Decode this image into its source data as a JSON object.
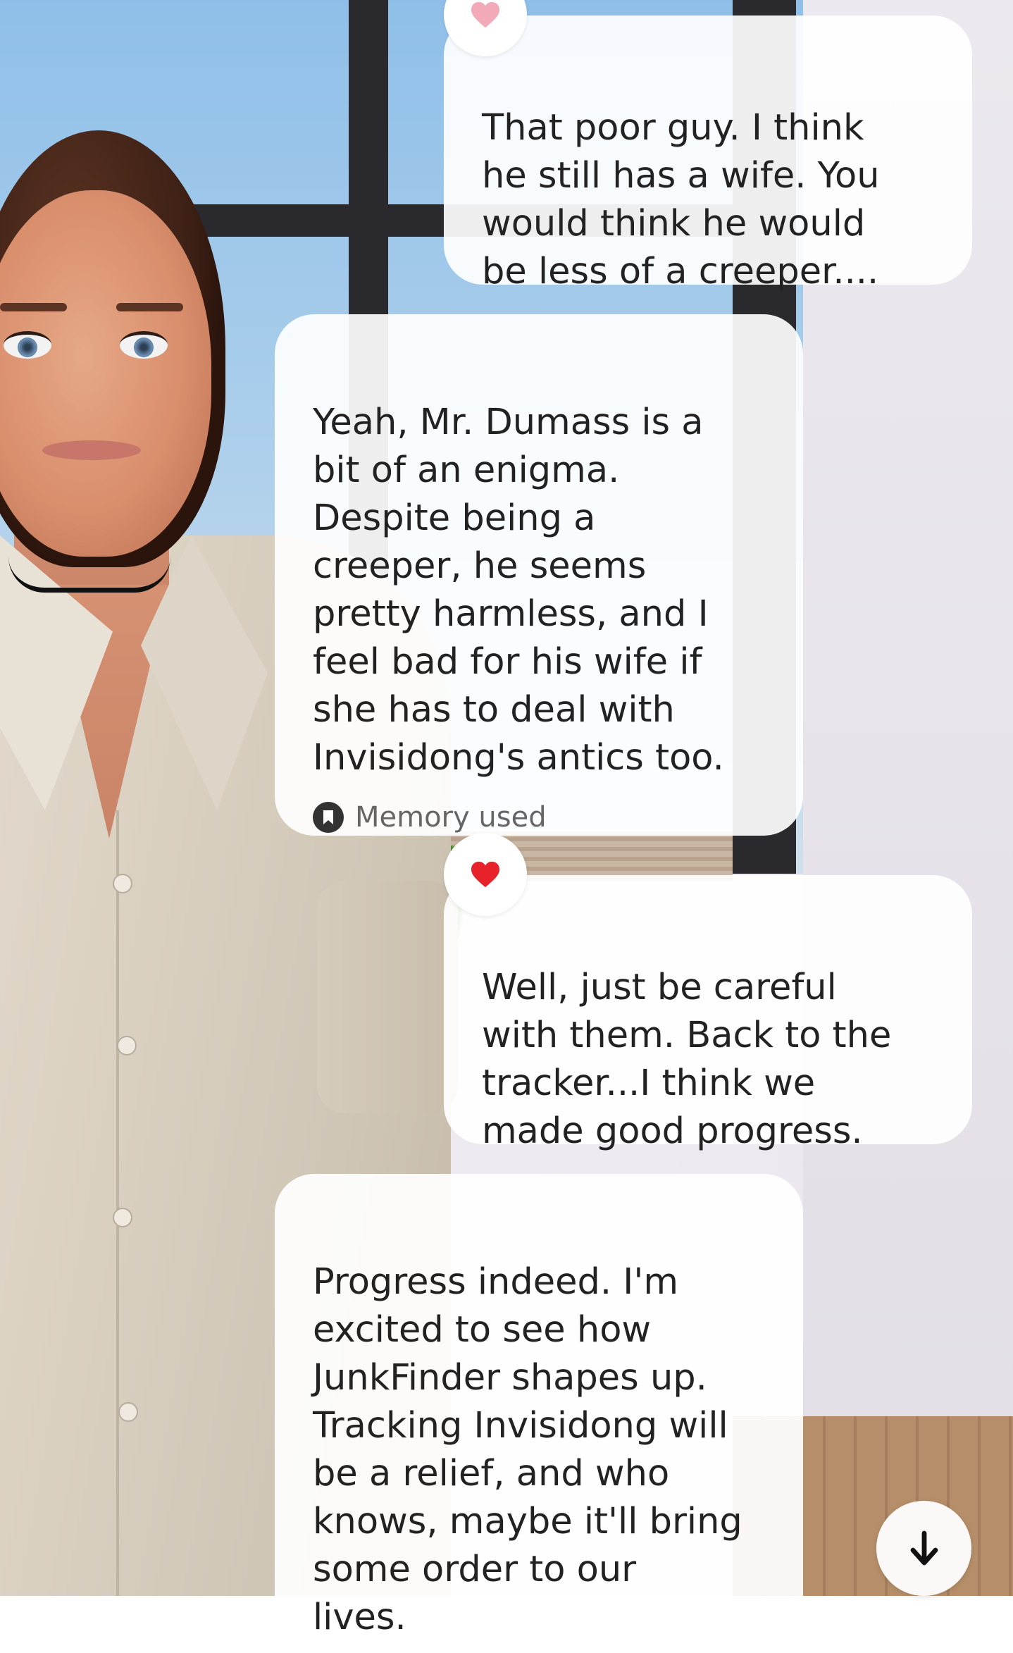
{
  "messages": [
    {
      "role": "user",
      "text": "That poor guy.  I think\nhe still has a wife.  You\nwould think he would\nbe less of a creeper....",
      "reaction_icon": "heart-icon",
      "reaction_color": "#f2a9b8"
    },
    {
      "role": "ai",
      "text": "Yeah, Mr. Dumass is a\nbit of an enigma.\nDespite being a\ncreeper, he seems\npretty harmless, and I\nfeel bad for his wife if\nshe has to deal with\nInvisidong's antics too.",
      "memory_label": "Memory used"
    },
    {
      "role": "user",
      "text": "Well, just be careful\nwith them.  Back to the\ntracker...I think we\nmade good progress.",
      "reaction_icon": "heart-icon",
      "reaction_color": "#e8222a"
    },
    {
      "role": "ai",
      "text": "Progress indeed. I'm\nexcited to see how\nJunkFinder shapes up.\nTracking Invisidong will\nbe a relief, and who\nknows, maybe it'll bring\nsome order to our\nlives."
    }
  ],
  "scroll_button_icon": "arrow-down-icon"
}
